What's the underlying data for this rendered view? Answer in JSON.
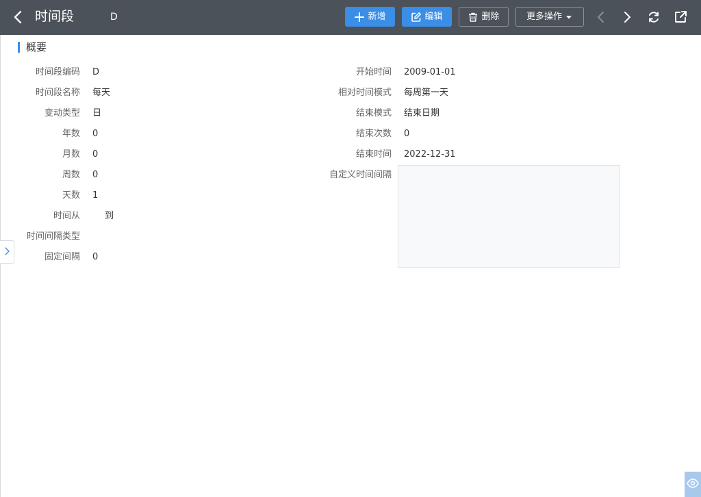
{
  "header": {
    "title": "时间段",
    "code": "D",
    "buttons": {
      "add": "新增",
      "edit": "编辑",
      "delete": "删除",
      "more": "更多操作"
    }
  },
  "section": {
    "title": "概要"
  },
  "fields_left": [
    {
      "label": "时间段编码",
      "value": "D"
    },
    {
      "label": "时间段名称",
      "value": "每天"
    },
    {
      "label": "变动类型",
      "value": "日"
    },
    {
      "label": "年数",
      "value": "0"
    },
    {
      "label": "月数",
      "value": "0"
    },
    {
      "label": "周数",
      "value": "0"
    },
    {
      "label": "天数",
      "value": "1"
    },
    {
      "label": "时间从",
      "value": "到"
    },
    {
      "label": "时间间隔类型",
      "value": ""
    },
    {
      "label": "固定间隔",
      "value": "0"
    }
  ],
  "fields_right": [
    {
      "label": "开始时间",
      "value": "2009-01-01"
    },
    {
      "label": "相对时间模式",
      "value": "每周第一天"
    },
    {
      "label": "结束模式",
      "value": "结束日期"
    },
    {
      "label": "结束次数",
      "value": "0"
    },
    {
      "label": "结束时间",
      "value": "2022-12-31"
    },
    {
      "label": "自定义时间间隔",
      "value": ""
    }
  ],
  "colors": {
    "header_bg": "#4b5259",
    "primary": "#3a8ee6",
    "accent_bar": "#3a8ee6"
  },
  "icons": {
    "back": "chevron-left-icon",
    "add": "plus-icon",
    "edit": "edit-icon",
    "delete": "trash-icon",
    "more": "caret-down-icon",
    "prev": "chevron-left-icon",
    "next": "chevron-right-icon",
    "refresh": "refresh-icon",
    "share": "share-icon",
    "expand": "chevron-right-icon",
    "eye": "eye-icon"
  }
}
